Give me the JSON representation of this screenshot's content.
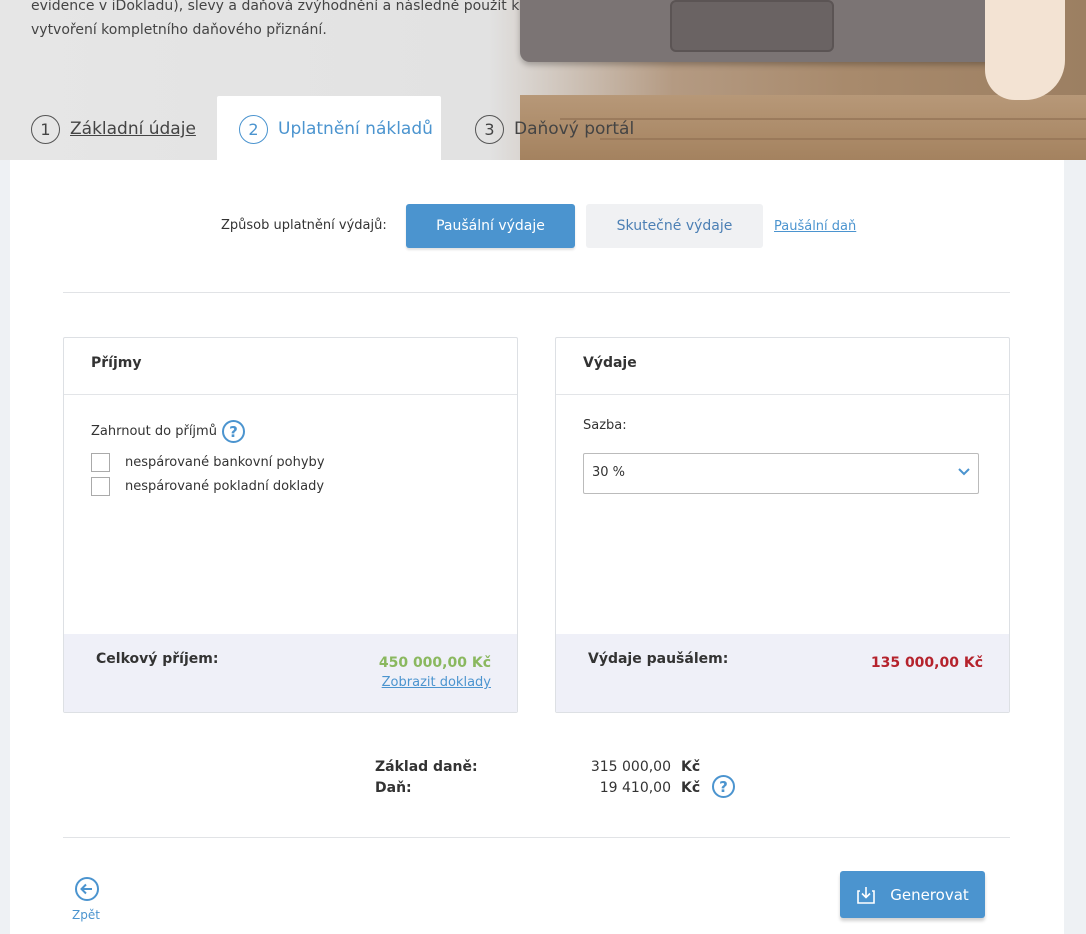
{
  "hero": {
    "text": "evidence v iDokladu), slevy a daňová zvýhodnění a následně použít k vytvoření kompletního daňového přiznání."
  },
  "steps": [
    {
      "num": "1",
      "label": "Základní údaje"
    },
    {
      "num": "2",
      "label": "Uplatnění nákladů"
    },
    {
      "num": "3",
      "label": "Daňový portál"
    }
  ],
  "method": {
    "label": "Způsob uplatnění výdajů:",
    "pausal_label": "Paušální výdaje",
    "skutecne_label": "Skutečné výdaje",
    "pausal_dan_link": "Paušální daň"
  },
  "income": {
    "title": "Příjmy",
    "include_label": "Zahrnout do příjmů",
    "options": [
      "nespárované bankovní pohyby",
      "nespárované pokladní doklady"
    ],
    "total_label": "Celkový příjem:",
    "total_value": "450 000,00 Kč",
    "show_docs_link": "Zobrazit doklady"
  },
  "expenses": {
    "title": "Výdaje",
    "rate_label": "Sazba:",
    "rate_value": "30 %",
    "total_label": "Výdaje paušálem:",
    "total_value": "135 000,00 Kč"
  },
  "summary": {
    "base_label": "Základ daně:",
    "base_value": "315 000,00",
    "tax_label": "Daň:",
    "tax_value": "19 410,00",
    "currency": "Kč"
  },
  "nav": {
    "back_label": "Zpět",
    "generate_label": "Generovat"
  },
  "icons": {
    "help": "?"
  },
  "colors": {
    "accent": "#4b94cf",
    "income": "#8ab85f",
    "expense": "#b5232d"
  }
}
